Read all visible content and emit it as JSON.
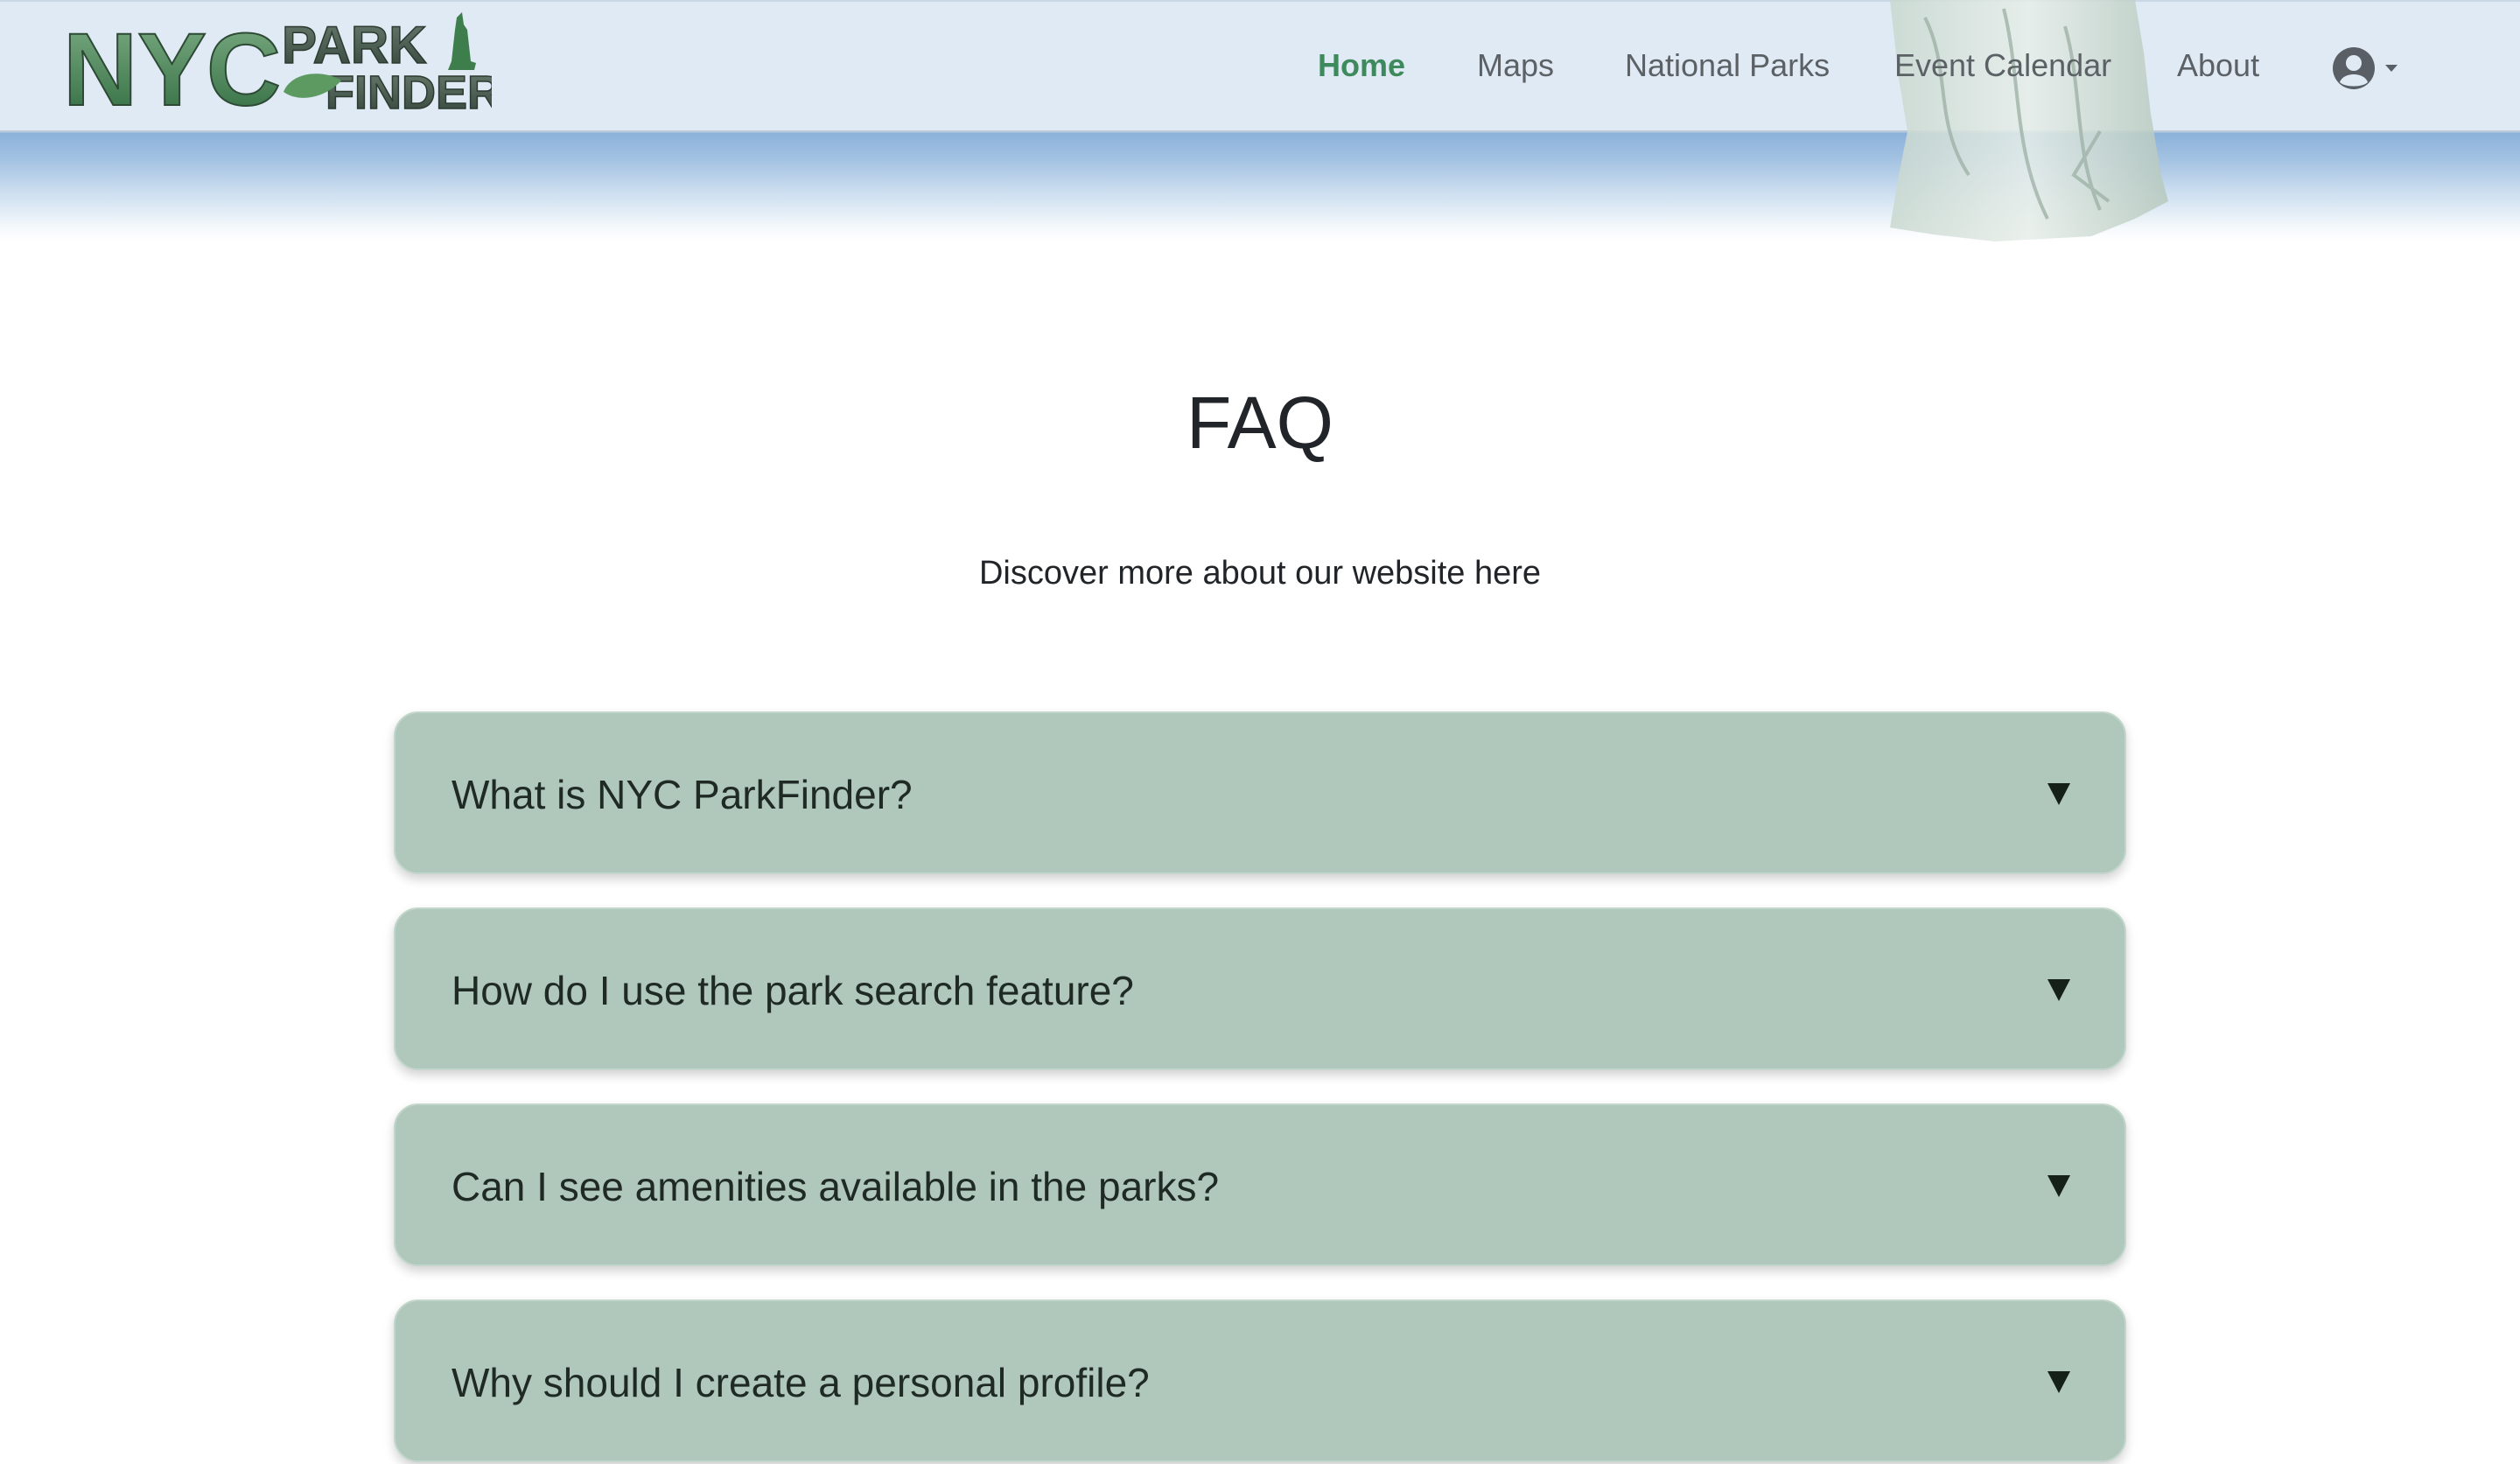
{
  "brand": {
    "logo_text_main": "NYC",
    "logo_text_top": "PARK",
    "logo_text_bottom": "FINDER"
  },
  "nav": {
    "items": [
      {
        "label": "Home",
        "active": true
      },
      {
        "label": "Maps",
        "active": false
      },
      {
        "label": "National Parks",
        "active": false
      },
      {
        "label": "Event Calendar",
        "active": false
      },
      {
        "label": "About",
        "active": false
      }
    ],
    "account_icon": "user-circle-icon"
  },
  "page": {
    "title": "FAQ",
    "subtitle": "Discover more about our website here"
  },
  "faq": {
    "items": [
      {
        "question": "What is NYC ParkFinder?",
        "expanded": false
      },
      {
        "question": "How do I use the park search feature?",
        "expanded": false
      },
      {
        "question": "Can I see amenities available in the parks?",
        "expanded": false
      },
      {
        "question": "Why should I create a personal profile?",
        "expanded": false
      }
    ]
  },
  "colors": {
    "accent": "#3f8a5d",
    "faq_bg": "#afc8bb",
    "nav_bg": "#e0eaf5"
  }
}
